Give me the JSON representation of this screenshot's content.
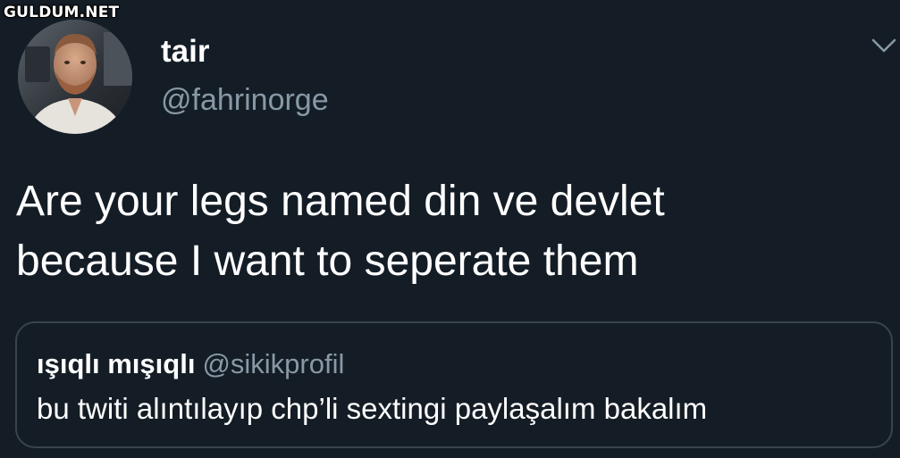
{
  "watermark": "GULDUM.NET",
  "tweet": {
    "display_name": "tair",
    "handle": "@fahrinorge",
    "text_lines": [
      "Are your legs named din ve devlet",
      "because I want to seperate them"
    ],
    "menu_icon": "chevron-down-icon"
  },
  "quoted_tweet": {
    "display_name": "ışıqlı mışıqlı",
    "handle": "@sikikprofil",
    "text": "bu twiti alıntılayıp chp’li sextingi paylaşalım bakalım"
  },
  "colors": {
    "background": "#141d26",
    "primary_text": "#ffffff",
    "secondary_text": "#8899a6",
    "border": "#38444d"
  }
}
